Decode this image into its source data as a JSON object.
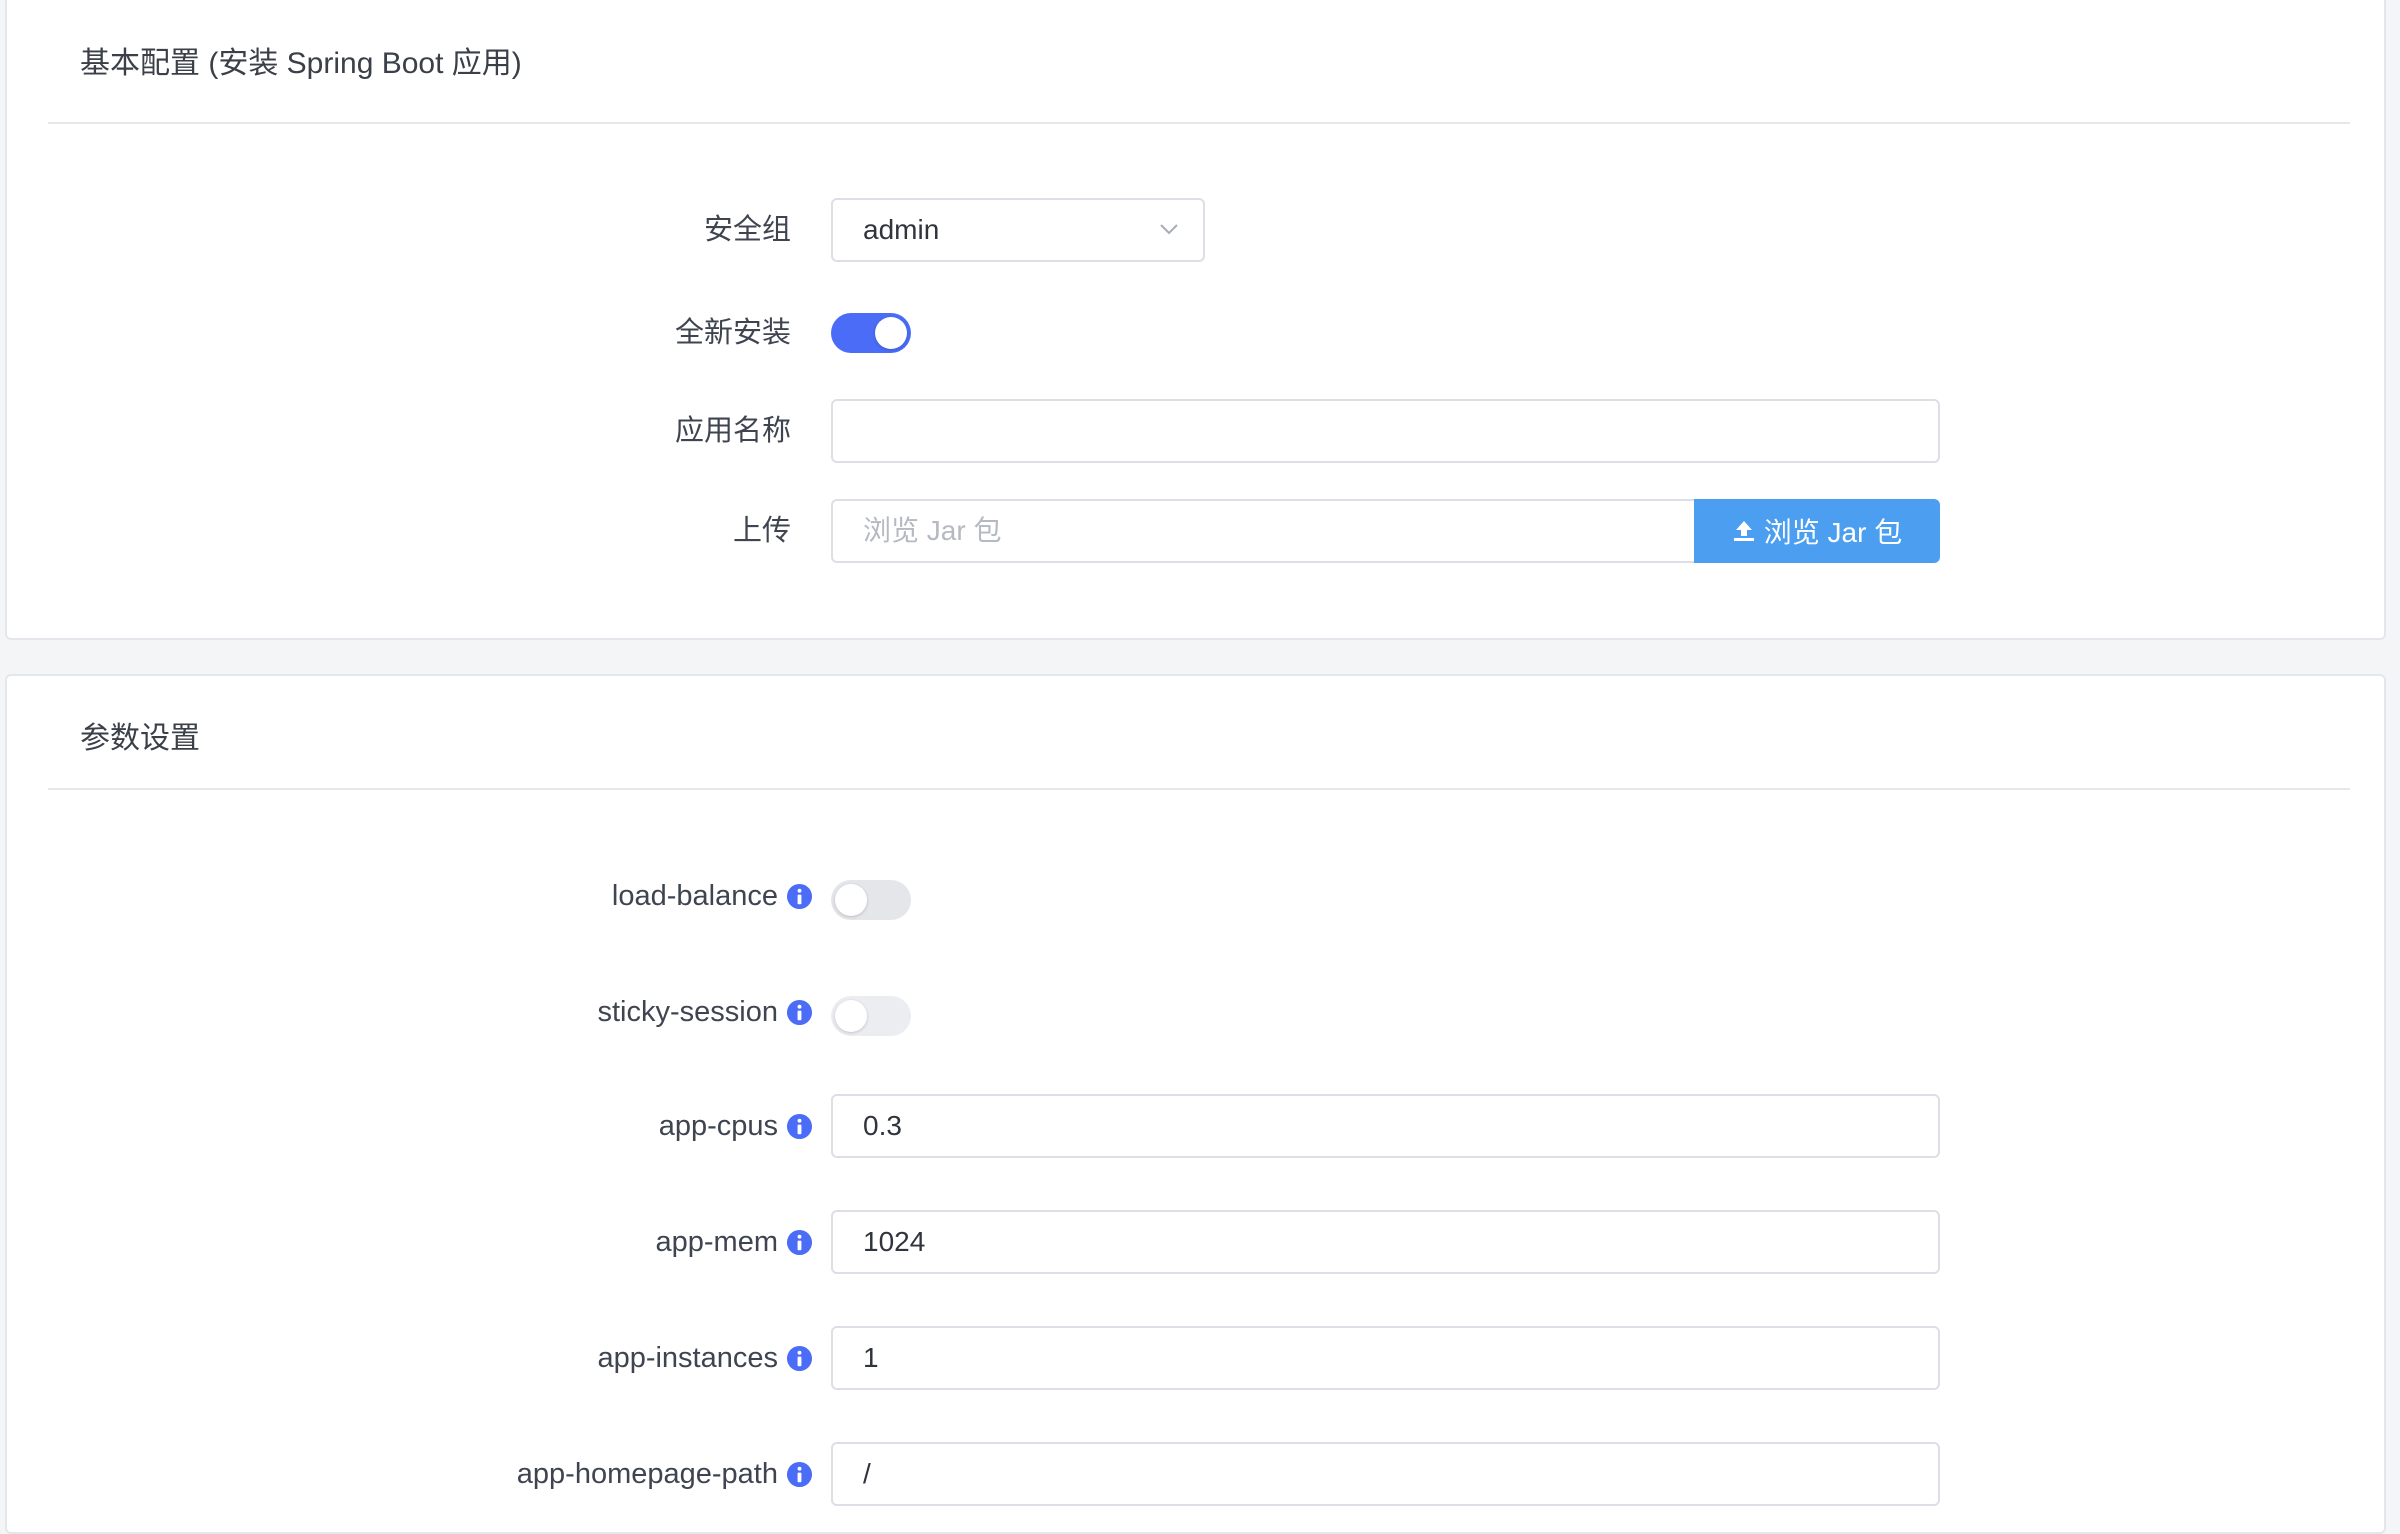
{
  "basic_section": {
    "title": "基本配置 (安装 Spring Boot 应用)",
    "security_group": {
      "label": "安全组",
      "value": "admin"
    },
    "fresh_install": {
      "label": "全新安装",
      "enabled": true
    },
    "app_name": {
      "label": "应用名称",
      "value": ""
    },
    "upload": {
      "label": "上传",
      "placeholder": "浏览 Jar 包",
      "button_label": "浏览 Jar 包"
    }
  },
  "params_section": {
    "title": "参数设置",
    "load_balance": {
      "label": "load-balance",
      "enabled": false
    },
    "sticky_session": {
      "label": "sticky-session",
      "enabled": false
    },
    "app_cpus": {
      "label": "app-cpus",
      "value": "0.3"
    },
    "app_mem": {
      "label": "app-mem",
      "value": "1024"
    },
    "app_instances": {
      "label": "app-instances",
      "value": "1"
    },
    "app_homepage_path": {
      "label": "app-homepage-path",
      "value": "/"
    }
  },
  "icons": {
    "info": "info-circle-icon",
    "chevron": "chevron-down-icon",
    "upload": "upload-icon"
  },
  "colors": {
    "accent": "#4a6cf7",
    "upload_button": "#4b9ef0",
    "toggle_off": "#e4e6ea",
    "border": "#dcdfe5"
  }
}
